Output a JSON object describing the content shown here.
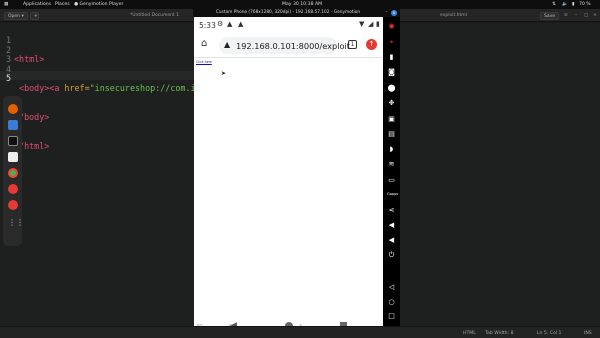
{
  "topbar": {
    "menu1": "Applications",
    "menu2": "Places",
    "app_name": "Genymotion Player",
    "clock": "May 30  10:38 AM",
    "battery": "70 %"
  },
  "editor": {
    "open_label": "Open",
    "tab_left": "*Untitled Document 1",
    "tab_right": "exploit.html",
    "save_label": "Save",
    "gutter": [
      "1",
      "2",
      "3",
      "4",
      "5"
    ],
    "lines": {
      "l1_tag": "<html>",
      "l2_tag_open": " <body><a ",
      "l2_attr": "href=",
      "l2_str": "\"insecureshop://com.insecur",
      "l3_tag": "</body>",
      "l4_tag": "</html>"
    }
  },
  "status": {
    "lang": "HTML",
    "tab_width": "Tab Width: 8",
    "position": "Ln 5, Col 1",
    "mode": "INS"
  },
  "genymotion": {
    "window_title": "Custom Phone (768x1280, 320dpi) - 192.168.57.102 - Genymotion"
  },
  "phone": {
    "time": "5:33",
    "url": "192.168.0.101:8000/exploit",
    "tab_count": "1",
    "page_link": "Click here",
    "watermark": "Free for personal use"
  }
}
